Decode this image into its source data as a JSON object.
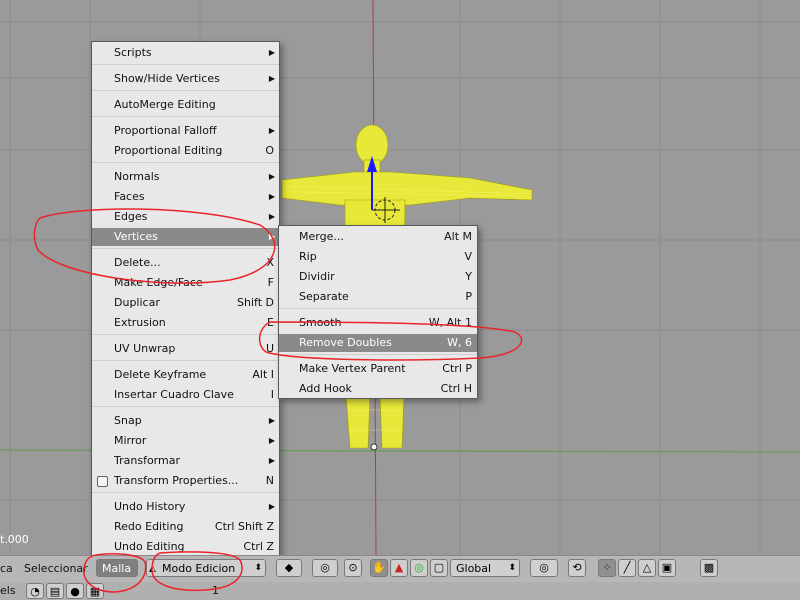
{
  "viewport": {
    "object_label": "t.000"
  },
  "mesh_menu": {
    "items": [
      {
        "label": "Scripts",
        "shortcut": "",
        "arrow": true
      },
      {
        "label": "Show/Hide Vertices",
        "shortcut": "",
        "arrow": true
      },
      {
        "label": "AutoMerge Editing",
        "shortcut": "",
        "arrow": false
      },
      {
        "label": "Proportional Falloff",
        "shortcut": "",
        "arrow": true
      },
      {
        "label": "Proportional Editing",
        "shortcut": "O",
        "arrow": false
      },
      {
        "label": "Normals",
        "shortcut": "",
        "arrow": true
      },
      {
        "label": "Faces",
        "shortcut": "",
        "arrow": true
      },
      {
        "label": "Edges",
        "shortcut": "",
        "arrow": true
      },
      {
        "label": "Vertices",
        "shortcut": "",
        "arrow": true
      },
      {
        "label": "Delete...",
        "shortcut": "X",
        "arrow": false
      },
      {
        "label": "Make Edge/Face",
        "shortcut": "F",
        "arrow": false
      },
      {
        "label": "Duplicar",
        "shortcut": "Shift D",
        "arrow": false
      },
      {
        "label": "Extrusion",
        "shortcut": "E",
        "arrow": false
      },
      {
        "label": "UV Unwrap",
        "shortcut": "U",
        "arrow": false
      },
      {
        "label": "Delete Keyframe",
        "shortcut": "Alt I",
        "arrow": false
      },
      {
        "label": "Insertar Cuadro Clave",
        "shortcut": "I",
        "arrow": false
      },
      {
        "label": "Snap",
        "shortcut": "",
        "arrow": true
      },
      {
        "label": "Mirror",
        "shortcut": "",
        "arrow": true
      },
      {
        "label": "Transformar",
        "shortcut": "",
        "arrow": true
      },
      {
        "label": "Transform Properties...",
        "shortcut": "N",
        "arrow": false
      },
      {
        "label": "Undo History",
        "shortcut": "",
        "arrow": true
      },
      {
        "label": "Redo Editing",
        "shortcut": "Ctrl Shift Z",
        "arrow": false
      },
      {
        "label": "Undo Editing",
        "shortcut": "Ctrl Z",
        "arrow": false
      }
    ]
  },
  "vertices_submenu": {
    "items": [
      {
        "label": "Merge...",
        "shortcut": "Alt M"
      },
      {
        "label": "Rip",
        "shortcut": "V"
      },
      {
        "label": "Dividir",
        "shortcut": "Y"
      },
      {
        "label": "Separate",
        "shortcut": "P"
      },
      {
        "label": "Smooth",
        "shortcut": "W, Alt 1"
      },
      {
        "label": "Remove Doubles",
        "shortcut": "W, 6"
      },
      {
        "label": "Make Vertex Parent",
        "shortcut": "Ctrl P"
      },
      {
        "label": "Add Hook",
        "shortcut": "Ctrl H"
      }
    ]
  },
  "header": {
    "left_fragment": "ca",
    "select_menu": "Seleccionar",
    "mesh_menu": "Malla",
    "mode": "Modo Edicion",
    "orientation": "Global"
  },
  "bottom": {
    "left_fragment": "els",
    "frame": "1"
  },
  "colors": {
    "viewport": "#9a9a9a",
    "mesh": "#ffff3a",
    "annotation": "#e8262a",
    "menu_bg": "#e8e8e8",
    "highlight": "#8a8a8a"
  }
}
